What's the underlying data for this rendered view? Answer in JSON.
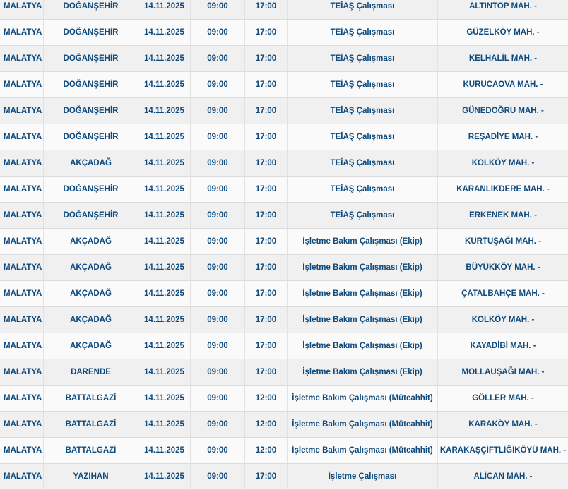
{
  "rows": [
    {
      "il": "MALATYA",
      "ilce": "DOĞANŞEHİR",
      "tarih": "14.11.2025",
      "baslangic": "09:00",
      "bitis": "17:00",
      "neden": "TEİAŞ Çalışması",
      "mahalle": "ALTINTOP MAH. -"
    },
    {
      "il": "MALATYA",
      "ilce": "DOĞANŞEHİR",
      "tarih": "14.11.2025",
      "baslangic": "09:00",
      "bitis": "17:00",
      "neden": "TEİAŞ Çalışması",
      "mahalle": "GÜZELKÖY MAH. -"
    },
    {
      "il": "MALATYA",
      "ilce": "DOĞANŞEHİR",
      "tarih": "14.11.2025",
      "baslangic": "09:00",
      "bitis": "17:00",
      "neden": "TEİAŞ Çalışması",
      "mahalle": "KELHALİL MAH. -"
    },
    {
      "il": "MALATYA",
      "ilce": "DOĞANŞEHİR",
      "tarih": "14.11.2025",
      "baslangic": "09:00",
      "bitis": "17:00",
      "neden": "TEİAŞ Çalışması",
      "mahalle": "KURUCAOVA MAH. -"
    },
    {
      "il": "MALATYA",
      "ilce": "DOĞANŞEHİR",
      "tarih": "14.11.2025",
      "baslangic": "09:00",
      "bitis": "17:00",
      "neden": "TEİAŞ Çalışması",
      "mahalle": "GÜNEDOĞRU MAH. -"
    },
    {
      "il": "MALATYA",
      "ilce": "DOĞANŞEHİR",
      "tarih": "14.11.2025",
      "baslangic": "09:00",
      "bitis": "17:00",
      "neden": "TEİAŞ Çalışması",
      "mahalle": "REŞADİYE MAH. -"
    },
    {
      "il": "MALATYA",
      "ilce": "AKÇADAĞ",
      "tarih": "14.11.2025",
      "baslangic": "09:00",
      "bitis": "17:00",
      "neden": "TEİAŞ Çalışması",
      "mahalle": "KOLKÖY MAH. -"
    },
    {
      "il": "MALATYA",
      "ilce": "DOĞANŞEHİR",
      "tarih": "14.11.2025",
      "baslangic": "09:00",
      "bitis": "17:00",
      "neden": "TEİAŞ Çalışması",
      "mahalle": "KARANLIKDERE MAH. -"
    },
    {
      "il": "MALATYA",
      "ilce": "DOĞANŞEHİR",
      "tarih": "14.11.2025",
      "baslangic": "09:00",
      "bitis": "17:00",
      "neden": "TEİAŞ Çalışması",
      "mahalle": "ERKENEK MAH. -"
    },
    {
      "il": "MALATYA",
      "ilce": "AKÇADAĞ",
      "tarih": "14.11.2025",
      "baslangic": "09:00",
      "bitis": "17:00",
      "neden": "İşletme Bakım Çalışması (Ekip)",
      "mahalle": "KURTUŞAĞI MAH. -"
    },
    {
      "il": "MALATYA",
      "ilce": "AKÇADAĞ",
      "tarih": "14.11.2025",
      "baslangic": "09:00",
      "bitis": "17:00",
      "neden": "İşletme Bakım Çalışması (Ekip)",
      "mahalle": "BÜYÜKKÖY MAH. -"
    },
    {
      "il": "MALATYA",
      "ilce": "AKÇADAĞ",
      "tarih": "14.11.2025",
      "baslangic": "09:00",
      "bitis": "17:00",
      "neden": "İşletme Bakım Çalışması (Ekip)",
      "mahalle": "ÇATALBAHÇE MAH. -"
    },
    {
      "il": "MALATYA",
      "ilce": "AKÇADAĞ",
      "tarih": "14.11.2025",
      "baslangic": "09:00",
      "bitis": "17:00",
      "neden": "İşletme Bakım Çalışması (Ekip)",
      "mahalle": "KOLKÖY MAH. -"
    },
    {
      "il": "MALATYA",
      "ilce": "AKÇADAĞ",
      "tarih": "14.11.2025",
      "baslangic": "09:00",
      "bitis": "17:00",
      "neden": "İşletme Bakım Çalışması (Ekip)",
      "mahalle": "KAYADİBİ MAH. -"
    },
    {
      "il": "MALATYA",
      "ilce": "DARENDE",
      "tarih": "14.11.2025",
      "baslangic": "09:00",
      "bitis": "17:00",
      "neden": "İşletme Bakım Çalışması (Ekip)",
      "mahalle": "MOLLAUŞAĞI MAH. -"
    },
    {
      "il": "MALATYA",
      "ilce": "BATTALGAZİ",
      "tarih": "14.11.2025",
      "baslangic": "09:00",
      "bitis": "12:00",
      "neden": "İşletme Bakım Çalışması (Müteahhit)",
      "mahalle": "GÖLLER MAH. -"
    },
    {
      "il": "MALATYA",
      "ilce": "BATTALGAZİ",
      "tarih": "14.11.2025",
      "baslangic": "09:00",
      "bitis": "12:00",
      "neden": "İşletme Bakım Çalışması (Müteahhit)",
      "mahalle": "KARAKÖY MAH. -"
    },
    {
      "il": "MALATYA",
      "ilce": "BATTALGAZİ",
      "tarih": "14.11.2025",
      "baslangic": "09:00",
      "bitis": "12:00",
      "neden": "İşletme Bakım Çalışması (Müteahhit)",
      "mahalle": "KARAKAŞÇİFTLİĞİKÖYÜ MAH. -"
    },
    {
      "il": "MALATYA",
      "ilce": "YAZIHAN",
      "tarih": "14.11.2025",
      "baslangic": "09:00",
      "bitis": "17:00",
      "neden": "İşletme Çalışması",
      "mahalle": "ALİCAN MAH. -"
    }
  ]
}
